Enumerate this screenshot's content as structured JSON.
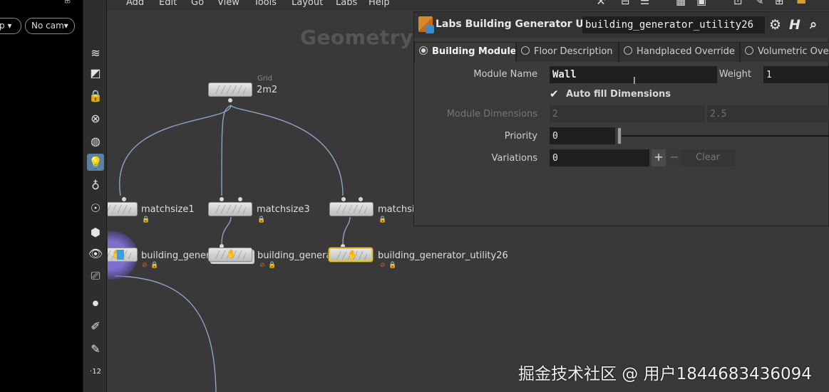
{
  "viewport": {
    "pill_left": "p",
    "pill_right": "No cam"
  },
  "menubar": [
    "Add",
    "Edit",
    "Go",
    "View",
    "Tools",
    "Layout",
    "Labs",
    "Help"
  ],
  "network": {
    "context_label": "Geometry",
    "nodes": {
      "grid": {
        "type": "Grid",
        "name": "2m2"
      },
      "matchsize1": {
        "name": "matchsize1"
      },
      "matchsize3": {
        "name": "matchsize3"
      },
      "matchsize_right": {
        "name": "matchsi"
      },
      "bg_left": {
        "name": "building_genera"
      },
      "bg_mid": {
        "name": "building_generat"
      },
      "bg_right": {
        "name": "building_generator_utility26"
      }
    }
  },
  "params": {
    "node_type": "Labs Building Generator Utility",
    "node_name": "building_generator_utility26",
    "tabs": [
      "Building Module",
      "Floor Description",
      "Handplaced Override",
      "Volumetric Over"
    ],
    "active_tab": 0,
    "module_name_label": "Module Name",
    "module_name_value": "Wall",
    "weight_label": "Weight",
    "weight_value": "1",
    "auto_fill_label": "Auto fill Dimensions",
    "auto_fill_checked": true,
    "module_dims_label": "Module Dimensions",
    "module_dims_x": "2",
    "module_dims_y": "2.5",
    "priority_label": "Priority",
    "priority_value": "0",
    "priority_slider": 0,
    "variations_label": "Variations",
    "variations_value": "0",
    "plus_label": "+",
    "minus_label": "−",
    "clear_label": "Clear"
  },
  "watermark": "掘金技术社区 @ 用户1844683436094",
  "colors": {
    "accent_select": "#e6c23a",
    "shelf_active": "#5c7fa6",
    "panel_bg": "#3b3b3b"
  }
}
